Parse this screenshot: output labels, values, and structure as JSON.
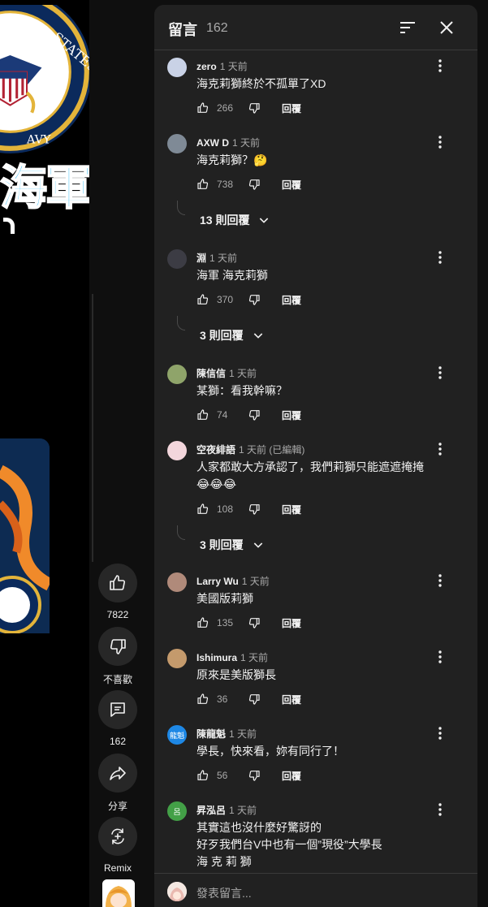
{
  "video": {
    "title_fragment": "海軍"
  },
  "actions": {
    "like_count": "7822",
    "dislike_label": "不喜歡",
    "comments_count": "162",
    "share_label": "分享",
    "remix_label": "Remix"
  },
  "panel": {
    "title": "留言",
    "count": "162",
    "add_comment_placeholder": "發表留言..."
  },
  "comments": [
    {
      "author": "zero",
      "time": "1 天前",
      "text": "海克莉獅終於不孤單了XD",
      "likes": "266",
      "reply_label": "回覆",
      "avatar_color": "#c9d2e6"
    },
    {
      "author": "AXW D",
      "time": "1 天前",
      "text": "海克莉獅？🤔",
      "likes": "738",
      "reply_label": "回覆",
      "replies": "13 則回覆",
      "avatar_color": "#7f8a96"
    },
    {
      "author": "淵",
      "time": "1 天前",
      "text": "海軍 海克莉獅",
      "likes": "370",
      "reply_label": "回覆",
      "replies": "3 則回覆",
      "avatar_color": "#3c3c44"
    },
    {
      "author": "陳信信",
      "time": "1 天前",
      "text": "某獅：看我幹嘛？",
      "likes": "74",
      "reply_label": "回覆",
      "avatar_color": "#8fa46a"
    },
    {
      "author": "空夜緋語",
      "time": "1 天前 (已編輯)",
      "text": "人家都敢大方承認了，我們莉獅只能遮遮掩掩😂😂😂",
      "likes": "108",
      "reply_label": "回覆",
      "replies": "3 則回覆",
      "avatar_color": "#f3d6dc"
    },
    {
      "author": "Larry Wu",
      "time": "1 天前",
      "text": "美國版莉獅",
      "likes": "135",
      "reply_label": "回覆",
      "avatar_color": "#b08a7a"
    },
    {
      "author": "Ishimura",
      "time": "1 天前",
      "text": "原來是美版獅長",
      "likes": "36",
      "reply_label": "回覆",
      "avatar_color": "#c49a6c"
    },
    {
      "author": "陳龍魁",
      "time": "1 天前",
      "text": "學長，快來看，妳有同行了！",
      "likes": "56",
      "reply_label": "回覆",
      "avatar_color": "#1e88e5",
      "avatar_text": "龍魁"
    },
    {
      "author": "昇泓呂",
      "time": "1 天前",
      "text": "其實這也沒什麼好驚訝的\n好歹我們台V中也有一個”現役”大學長\n海 克 莉 獅",
      "likes": "",
      "reply_label": "",
      "avatar_color": "#43a047",
      "avatar_text": "呂"
    }
  ]
}
